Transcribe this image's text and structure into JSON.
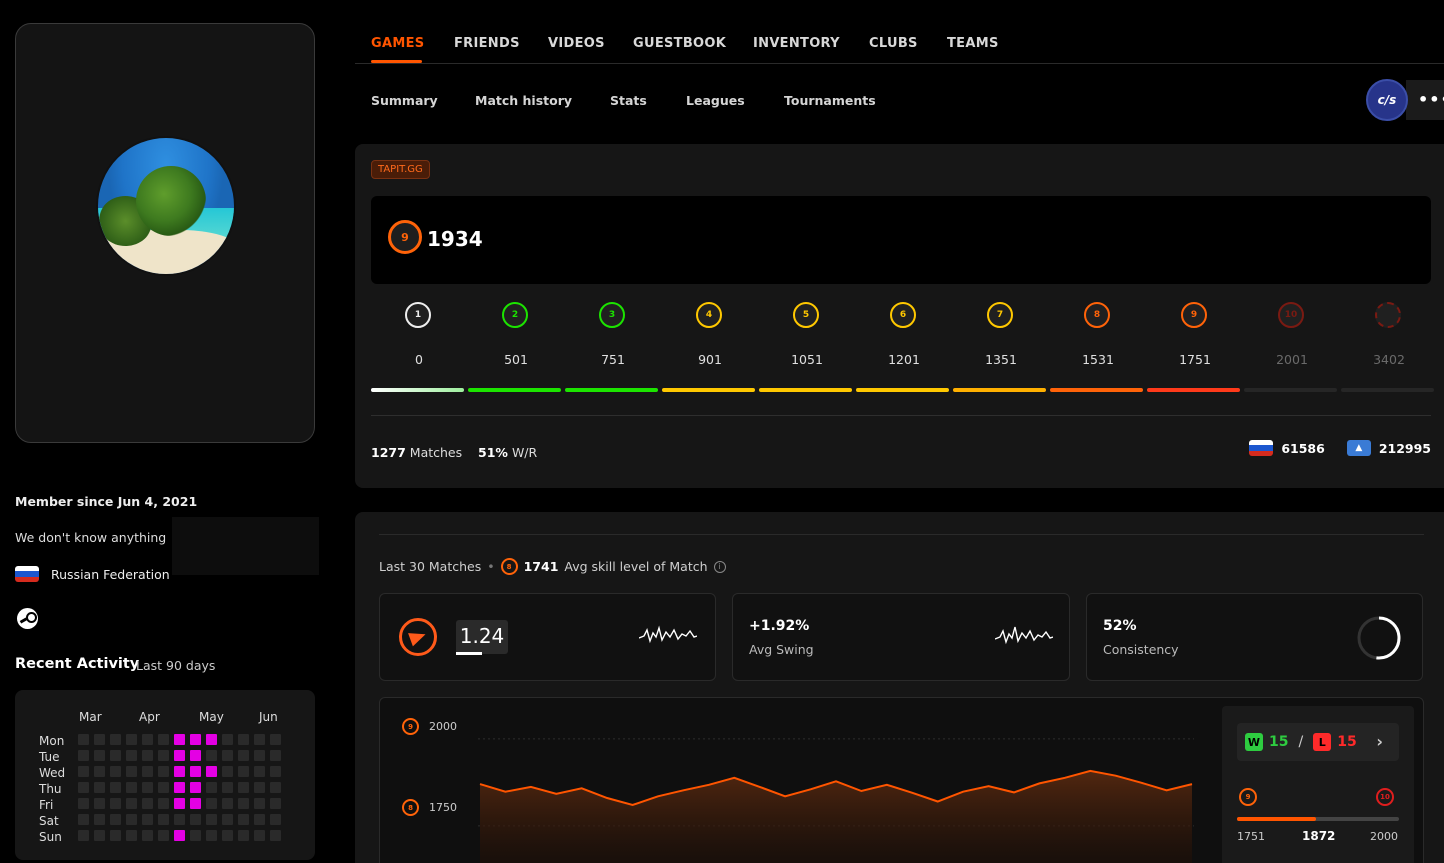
{
  "profile": {
    "member_since": "Member since Jun 4, 2021",
    "bio": "We don't know anything",
    "country": "Russian Federation",
    "country_flag_colors": [
      "#ffffff",
      "#1c57cf",
      "#d52b1e"
    ]
  },
  "activity": {
    "title": "Recent Activity",
    "subtitle": "Last 90 days",
    "months": [
      "Mar",
      "Apr",
      "May",
      "Jun"
    ],
    "days": [
      "Mon",
      "Tue",
      "Wed",
      "Thu",
      "Fri",
      "Sat",
      "Sun"
    ],
    "active_color": "#e400e4",
    "grid": [
      [
        0,
        0,
        0,
        0,
        0,
        0,
        1,
        1,
        1,
        0,
        0,
        0,
        0
      ],
      [
        0,
        0,
        0,
        0,
        0,
        0,
        1,
        1,
        0,
        0,
        0,
        0,
        0
      ],
      [
        0,
        0,
        0,
        0,
        0,
        0,
        1,
        1,
        1,
        0,
        0,
        0,
        0
      ],
      [
        0,
        0,
        0,
        0,
        0,
        0,
        1,
        1,
        0,
        0,
        0,
        0,
        0
      ],
      [
        0,
        0,
        0,
        0,
        0,
        0,
        1,
        1,
        0,
        0,
        0,
        0,
        0
      ],
      [
        0,
        0,
        0,
        0,
        0,
        0,
        0,
        0,
        0,
        0,
        0,
        0,
        0
      ],
      [
        0,
        0,
        0,
        0,
        0,
        0,
        1,
        0,
        0,
        0,
        0,
        0,
        0
      ]
    ]
  },
  "nav": {
    "tabs": [
      "GAMES",
      "FRIENDS",
      "VIDEOS",
      "GUESTBOOK",
      "INVENTORY",
      "CLUBS",
      "TEAMS"
    ],
    "active_tab": "GAMES",
    "subtabs": [
      "Summary",
      "Match history",
      "Stats",
      "Leagues",
      "Tournaments"
    ],
    "game_badge": "c/s",
    "more": "•••"
  },
  "skill": {
    "tag": "TAPIT.GG",
    "current_level": "9",
    "elo": "1934",
    "levels": [
      {
        "level": "1",
        "min": "0",
        "color": "#eeeeee",
        "bar": "#d9f7d9"
      },
      {
        "level": "2",
        "min": "501",
        "color": "#1ce400",
        "bar": "#1ce400"
      },
      {
        "level": "3",
        "min": "751",
        "color": "#1ce400",
        "bar": "#1ce400"
      },
      {
        "level": "4",
        "min": "901",
        "color": "#ffc800",
        "bar": "#ffc800"
      },
      {
        "level": "5",
        "min": "1051",
        "color": "#ffc800",
        "bar": "#ffc800"
      },
      {
        "level": "6",
        "min": "1201",
        "color": "#ffc800",
        "bar": "#ffc800"
      },
      {
        "level": "7",
        "min": "1351",
        "color": "#ffc800",
        "bar": "#ffb000"
      },
      {
        "level": "8",
        "min": "1531",
        "color": "#ff6309",
        "bar": "#ff6309"
      },
      {
        "level": "9",
        "min": "1751",
        "color": "#ff6309",
        "bar": "#ff3a1a"
      },
      {
        "level": "10",
        "min": "2001",
        "color": "#7a1a12",
        "bar": "#262626"
      },
      {
        "level": "",
        "min": "3402",
        "color": "#7a1a12",
        "bar": "#262626"
      }
    ],
    "matches": "1277",
    "matches_label": "Matches",
    "winrate": "51%",
    "winrate_label": "W/R",
    "country_rank": "61586",
    "region_rank": "212995"
  },
  "stats": {
    "header_prefix": "Last 30 Matches",
    "avg_level_icon": "8",
    "avg_skill": "1741",
    "avg_skill_label": "Avg skill level of Match",
    "kd": "1.24",
    "avg_swing": "+1.92%",
    "avg_swing_label": "Avg Swing",
    "consistency": "52%",
    "consistency_label": "Consistency",
    "wins": "15",
    "losses": "15",
    "wins_tag": "W",
    "losses_tag": "L",
    "separator": "/",
    "range_low": "1751",
    "range_current": "1872",
    "range_high": "2000",
    "range_low_level": "9",
    "range_high_level": "10",
    "progress_fraction": 0.49
  },
  "chart_data": {
    "type": "area",
    "title": "",
    "xlabel": "",
    "ylabel": "",
    "y_ticks": [
      {
        "level": "9",
        "value": "2000"
      },
      {
        "level": "8",
        "value": "1750"
      }
    ],
    "ylim": [
      1600,
      2060
    ],
    "series": [
      {
        "values": [
          1870,
          1848,
          1862,
          1842,
          1858,
          1830,
          1810,
          1835,
          1852,
          1868,
          1888,
          1862,
          1835,
          1855,
          1878,
          1850,
          1868,
          1845,
          1820,
          1848,
          1864,
          1846,
          1872,
          1888,
          1908,
          1894,
          1874,
          1852,
          1870
        ]
      }
    ],
    "color": "#ff5500"
  }
}
